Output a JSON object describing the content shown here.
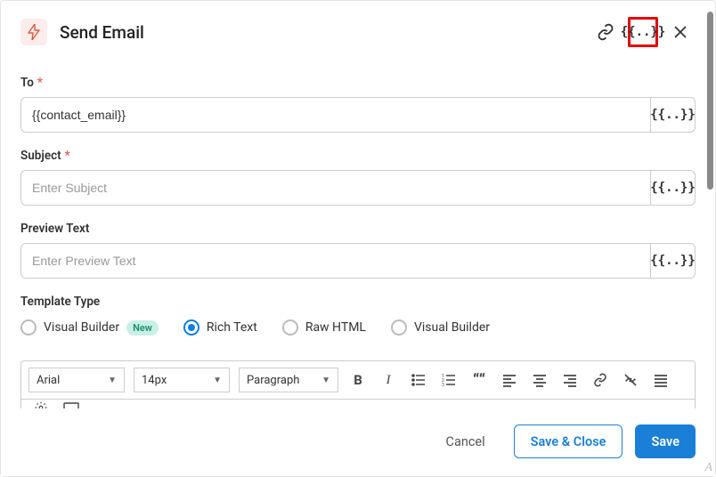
{
  "header": {
    "title": "Send Email"
  },
  "fields": {
    "to": {
      "label": "To",
      "required": "*",
      "value": "{{contact_email}}"
    },
    "subject": {
      "label": "Subject",
      "required": "*",
      "value": "",
      "placeholder": "Enter Subject"
    },
    "preview": {
      "label": "Preview Text",
      "value": "",
      "placeholder": "Enter Preview Text"
    }
  },
  "templateType": {
    "label": "Template Type",
    "options": {
      "vbNew": {
        "label": "Visual Builder",
        "badge": "New"
      },
      "rich": {
        "label": "Rich Text"
      },
      "raw": {
        "label": "Raw HTML"
      },
      "vb": {
        "label": "Visual Builder"
      }
    }
  },
  "editor": {
    "font": "Arial",
    "size": "14px",
    "block": "Paragraph"
  },
  "footer": {
    "cancel": "Cancel",
    "saveClose": "Save & Close",
    "save": "Save"
  },
  "tokenGlyph": "{{..}}"
}
